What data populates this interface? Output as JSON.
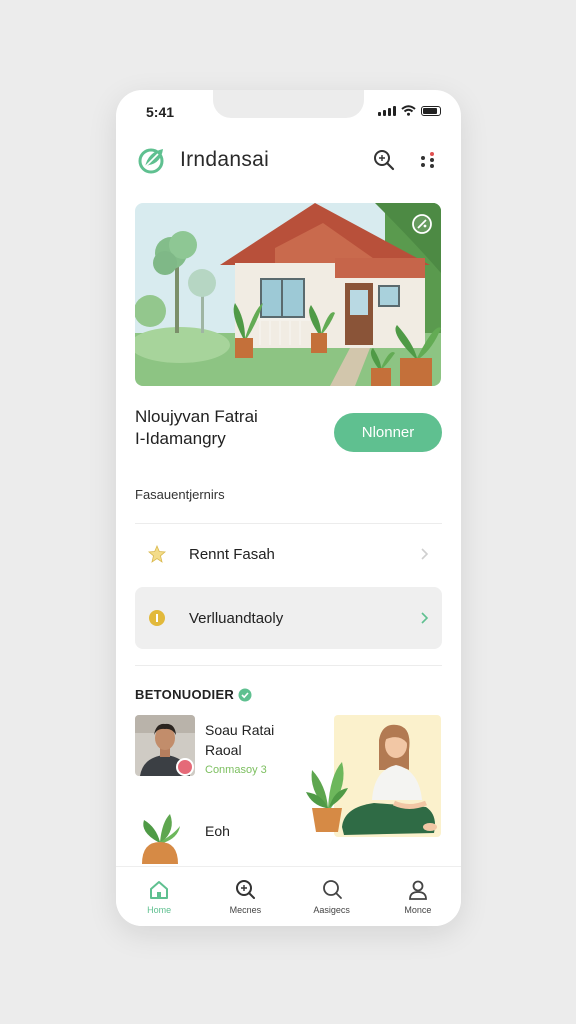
{
  "status": {
    "time": "5:41"
  },
  "header": {
    "app_name": "Irndansai"
  },
  "intro": {
    "line1": "Nloujyvan Fatrai",
    "line2": "I-Idamangry",
    "button": "Nlonner"
  },
  "section": {
    "label": "Fasauentjernirs"
  },
  "rows": [
    {
      "label": "Rennt Fasah"
    },
    {
      "label": "Verlluandtaoly"
    }
  ],
  "recommended": {
    "title": "BETONUODIER",
    "profile": {
      "name_line1": "Soau Ratai",
      "name_line2": "Raoal",
      "meta": "Conmasoy 3"
    },
    "bottom_label": "Eoh"
  },
  "tabs": [
    {
      "label": "Home"
    },
    {
      "label": "Mecnes"
    },
    {
      "label": "Aasigecs"
    },
    {
      "label": "Monce"
    }
  ],
  "colors": {
    "accent": "#5fc090",
    "badge": "#e56a78",
    "meta": "#7cbf5f"
  }
}
